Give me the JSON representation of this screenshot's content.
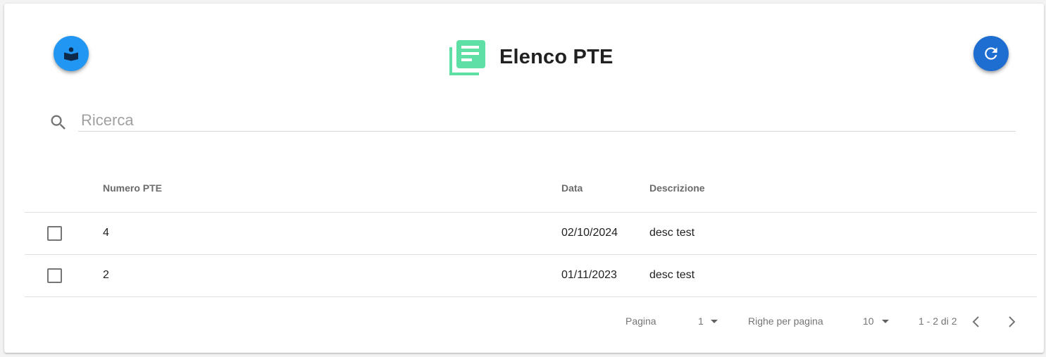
{
  "header": {
    "title": "Elenco PTE",
    "title_icon": "list-document-icon",
    "icon_color": "#5ddfa6"
  },
  "actions": {
    "left_button_icon": "reader-book-icon",
    "left_button_color": "#2196f3",
    "right_button_icon": "refresh-icon",
    "right_button_color": "#1e6ed2"
  },
  "search": {
    "placeholder": "Ricerca",
    "value": ""
  },
  "table": {
    "columns": [
      "Numero PTE",
      "Data",
      "Descrizione"
    ],
    "rows": [
      {
        "numero": "4",
        "data": "02/10/2024",
        "descrizione": "desc test",
        "selected": false
      },
      {
        "numero": "2",
        "data": "01/11/2023",
        "descrizione": "desc test",
        "selected": false
      }
    ]
  },
  "pagination": {
    "page_label": "Pagina",
    "page_value": "1",
    "rows_label": "Righe per pagina",
    "rows_value": "10",
    "range": "1 - 2 di 2"
  }
}
